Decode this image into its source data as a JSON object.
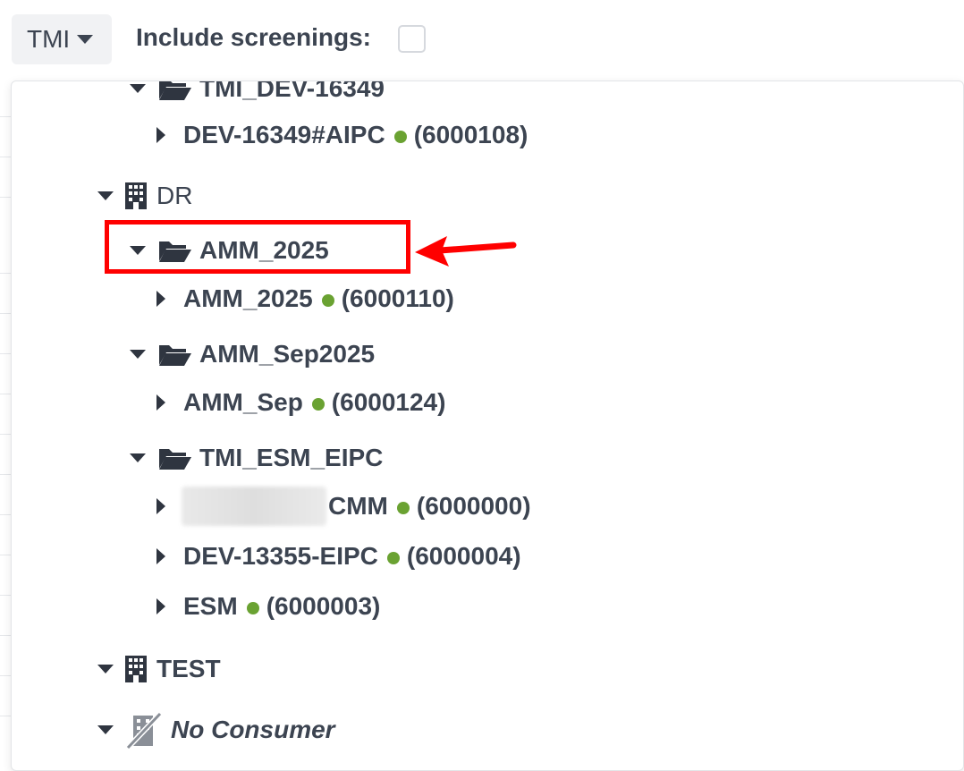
{
  "topbar": {
    "tenant_label": "TMI",
    "include_screenings_label": "Include screenings:",
    "include_screenings_checked": false
  },
  "tree": {
    "partial_top_folder": "TMI_DEV-16349",
    "dev16349_item": {
      "name": "DEV-16349#AIPC",
      "id": "(6000108)"
    },
    "dr": {
      "label": "DR",
      "amm2025_folder": "AMM_2025",
      "amm2025_item": {
        "name": "AMM_2025",
        "id": "(6000110)"
      },
      "ammsep_folder": "AMM_Sep2025",
      "ammsep_item": {
        "name": "AMM_Sep",
        "id": "(6000124)"
      },
      "esm_folder": "TMI_ESM_EIPC",
      "cmm_item": {
        "name": "CMM",
        "id": "(6000000)"
      },
      "dev13355_item": {
        "name": "DEV-13355-EIPC",
        "id": "(6000004)"
      },
      "esm_item": {
        "name": "ESM",
        "id": "(6000003)"
      }
    },
    "test_label": "TEST",
    "no_consumer_label": "No Consumer"
  },
  "colors": {
    "status_dot": "#6aa232",
    "highlight": "#ff0000",
    "text": "#3c4451"
  },
  "icons": [
    "caret-down-icon",
    "caret-right-icon",
    "folder-open-icon",
    "building-icon",
    "no-building-icon",
    "status-dot",
    "red-arrow"
  ]
}
